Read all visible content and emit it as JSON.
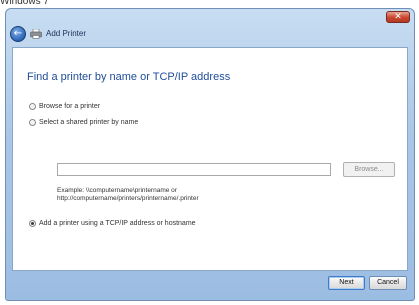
{
  "caption": "Windows 7",
  "window": {
    "close_label": "✕",
    "header_title": "Add Printer"
  },
  "main": {
    "heading": "Find a printer by name or TCP/IP address",
    "options": [
      {
        "label": "Browse for a printer",
        "checked": false
      },
      {
        "label": "Select a shared printer by name",
        "checked": false
      },
      {
        "label": "Add a printer using a TCP/IP address or hostname",
        "checked": true
      }
    ],
    "shared_printer_input": {
      "value": "",
      "placeholder": ""
    },
    "browse_label": "Browse...",
    "example_line1": "Example: \\\\computername\\printername or",
    "example_line2": "http://computername/printers/printername/.printer"
  },
  "footer": {
    "next_label": "Next",
    "cancel_label": "Cancel"
  },
  "icons": [
    "back-arrow-icon",
    "printer-icon",
    "close-icon"
  ],
  "colors": {
    "heading": "#1f4d99",
    "titlebar": "#a9c6e6",
    "close": "#c9452e"
  }
}
